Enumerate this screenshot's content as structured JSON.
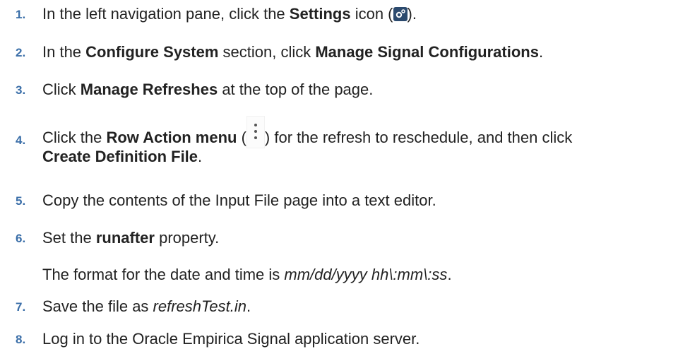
{
  "steps": [
    {
      "num": "1.",
      "a": "In the left navigation pane, click the ",
      "b": "Settings",
      "c": " icon (",
      "d": ")."
    },
    {
      "num": "2.",
      "a": "In the ",
      "b": "Configure System",
      "c": " section, click ",
      "d": "Manage Signal Configurations",
      "e": "."
    },
    {
      "num": "3.",
      "a": "Click ",
      "b": "Manage Refreshes",
      "c": " at the top of the page."
    },
    {
      "num": "4.",
      "a": "Click the ",
      "b": "Row Action menu",
      "c": " (",
      "d": ") for the refresh to reschedule, and then click",
      "e": "Create Definition File",
      "f": "."
    },
    {
      "num": "5.",
      "a": "Copy the contents of the Input File page into a text editor."
    },
    {
      "num": "6.",
      "a": "Set the ",
      "b": "runafter",
      "c": " property.",
      "note_a": "The format for the date and time is ",
      "note_i": "mm/dd/yyyy hh\\:mm\\:ss",
      "note_c": "."
    },
    {
      "num": "7.",
      "a": "Save the file as ",
      "i": "refreshTest.in",
      "c": "."
    },
    {
      "num": "8.",
      "a": "Log in to the Oracle Empirica Signal application server."
    }
  ],
  "icons": {
    "settings": "gear-icon",
    "row_action": "vertical-ellipsis-icon"
  },
  "colors": {
    "step_number": "#3a6ea8",
    "text": "#222222"
  }
}
